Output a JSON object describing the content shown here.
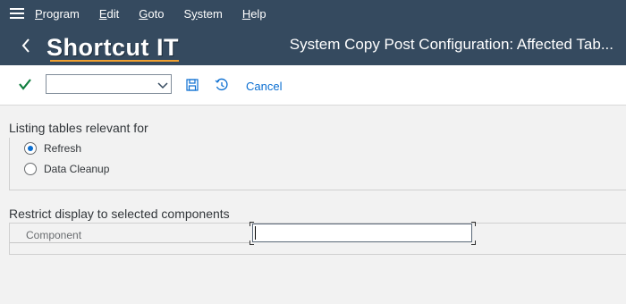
{
  "menubar": {
    "items": [
      "Program",
      "Edit",
      "Goto",
      "System",
      "Help"
    ],
    "mnemonics": [
      "P",
      "E",
      "G",
      "y",
      "H"
    ]
  },
  "titlebar": {
    "logo_text": "Shortcut IT",
    "title": "System Copy Post Configuration: Affected Tab..."
  },
  "toolbar": {
    "command_field_value": "",
    "cancel_label": "Cancel"
  },
  "listing_section": {
    "title": "Listing tables relevant for",
    "options": [
      {
        "label": "Refresh",
        "selected": true
      },
      {
        "label": "Data Cleanup",
        "selected": false
      }
    ]
  },
  "restrict_section": {
    "title": "Restrict display to selected components",
    "component_label": "Component",
    "component_value": ""
  },
  "colors": {
    "shell_header": "#354a5f",
    "accent": "#0a6ed1",
    "background": "#f2f2f2",
    "check_green": "#107e3e"
  },
  "icons": [
    "menu-icon",
    "back-icon",
    "checkmark-icon",
    "chevron-down-icon",
    "save-icon",
    "history-icon"
  ]
}
